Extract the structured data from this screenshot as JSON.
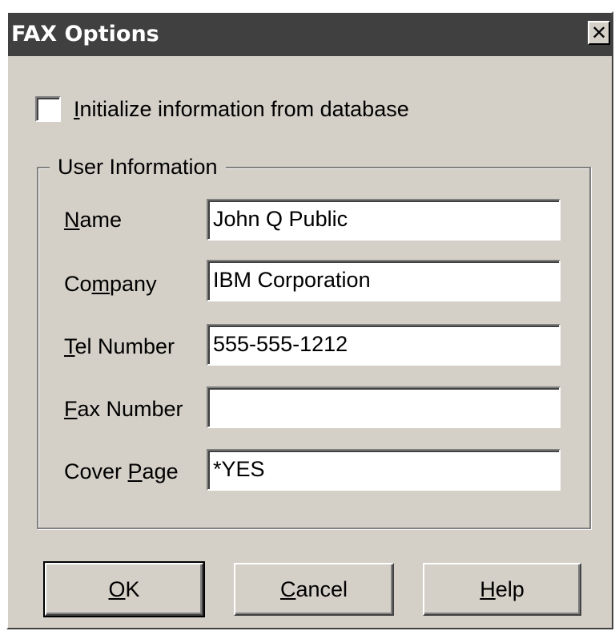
{
  "window": {
    "title": "FAX Options",
    "close_glyph": "✕"
  },
  "checkbox": {
    "label_mnemonic": "I",
    "label_rest": "nitialize information from database",
    "checked": false
  },
  "group": {
    "title": "User Information"
  },
  "fields": [
    {
      "label_pre": "",
      "label_mnemonic": "N",
      "label_post": "ame",
      "value": "John Q Public"
    },
    {
      "label_pre": "Co",
      "label_mnemonic": "m",
      "label_post": "pany",
      "value": "IBM Corporation"
    },
    {
      "label_pre": "",
      "label_mnemonic": "T",
      "label_post": "el Number",
      "value": "555-555-1212"
    },
    {
      "label_pre": "",
      "label_mnemonic": "F",
      "label_post": "ax Number",
      "value": ""
    },
    {
      "label_pre": "Cover ",
      "label_mnemonic": "P",
      "label_post": "age",
      "value": "*YES"
    }
  ],
  "buttons": {
    "ok": {
      "mnemonic": "O",
      "rest": "K"
    },
    "cancel": {
      "mnemonic": "C",
      "rest": "ancel"
    },
    "help": {
      "mnemonic": "H",
      "rest": "elp"
    }
  },
  "colors": {
    "titlebar": "#404040",
    "face": "#d4d0c8"
  },
  "icons": {
    "close": "close-icon"
  }
}
